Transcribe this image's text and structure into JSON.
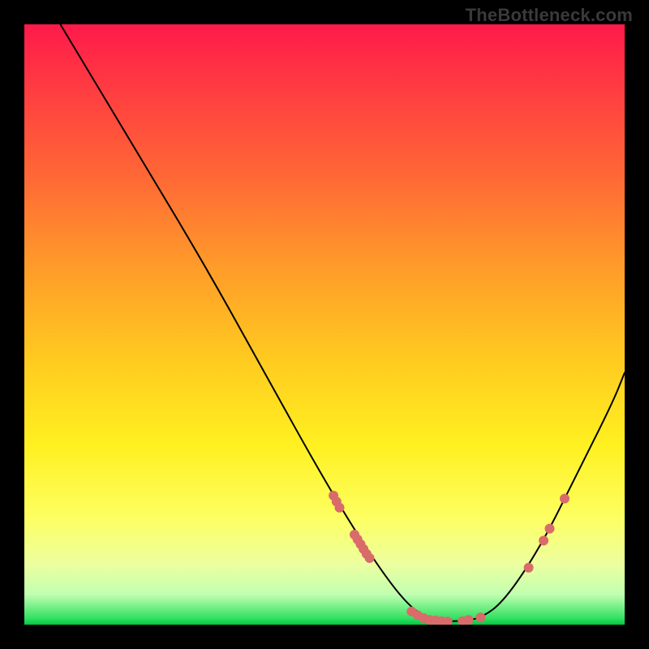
{
  "watermark": {
    "text": "TheBottleneck.com"
  },
  "chart_data": {
    "type": "line",
    "title": "",
    "xlabel": "",
    "ylabel": "",
    "xlim": [
      0,
      100
    ],
    "ylim": [
      0,
      100
    ],
    "grid": false,
    "curve": [
      {
        "x": 6,
        "y": 100
      },
      {
        "x": 18,
        "y": 80
      },
      {
        "x": 30,
        "y": 60
      },
      {
        "x": 40,
        "y": 42
      },
      {
        "x": 50,
        "y": 24
      },
      {
        "x": 58,
        "y": 11
      },
      {
        "x": 64,
        "y": 3
      },
      {
        "x": 68,
        "y": 0.7
      },
      {
        "x": 72,
        "y": 0.5
      },
      {
        "x": 76,
        "y": 1
      },
      {
        "x": 80,
        "y": 4
      },
      {
        "x": 86,
        "y": 13
      },
      {
        "x": 92,
        "y": 25
      },
      {
        "x": 98,
        "y": 37
      },
      {
        "x": 100,
        "y": 42
      }
    ],
    "markers": [
      {
        "x": 51.5,
        "y": 21.5
      },
      {
        "x": 52.0,
        "y": 20.5
      },
      {
        "x": 52.5,
        "y": 19.5
      },
      {
        "x": 55.0,
        "y": 15.0
      },
      {
        "x": 55.5,
        "y": 14.2
      },
      {
        "x": 56.0,
        "y": 13.4
      },
      {
        "x": 56.5,
        "y": 12.6
      },
      {
        "x": 57.0,
        "y": 11.8
      },
      {
        "x": 57.5,
        "y": 11.1
      },
      {
        "x": 64.5,
        "y": 2.2
      },
      {
        "x": 65.5,
        "y": 1.6
      },
      {
        "x": 66.5,
        "y": 1.1
      },
      {
        "x": 67.5,
        "y": 0.8
      },
      {
        "x": 68.5,
        "y": 0.7
      },
      {
        "x": 69.5,
        "y": 0.6
      },
      {
        "x": 70.5,
        "y": 0.5
      },
      {
        "x": 73.0,
        "y": 0.6
      },
      {
        "x": 74.0,
        "y": 0.8
      },
      {
        "x": 76.0,
        "y": 1.2
      },
      {
        "x": 84.0,
        "y": 9.5
      },
      {
        "x": 86.5,
        "y": 14.0
      },
      {
        "x": 87.5,
        "y": 16.0
      },
      {
        "x": 90.0,
        "y": 21.0
      }
    ],
    "marker_style": {
      "color": "#d96b6b",
      "radius": 6
    },
    "line_style": {
      "color": "#000000",
      "width": 2
    }
  }
}
